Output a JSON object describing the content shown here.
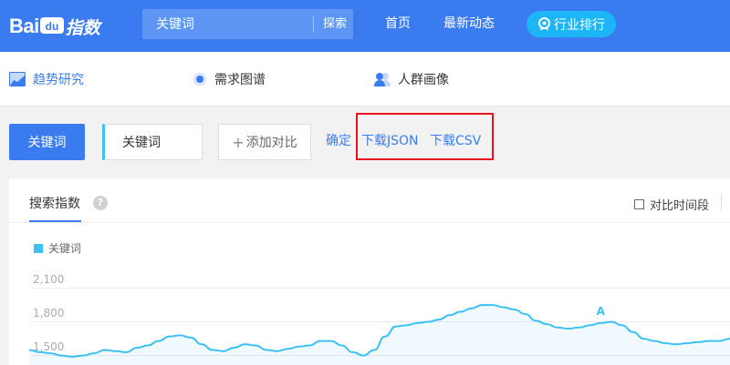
{
  "header": {
    "logo_text": "Bai",
    "logo_suffix": "指数",
    "search_placeholder": "关键词",
    "search_button": "探索",
    "nav": [
      "首页",
      "最新动态"
    ],
    "rank_button": "行业排行"
  },
  "tabs": [
    {
      "label": "趋势研究",
      "icon": "trend-icon"
    },
    {
      "label": "需求图谱",
      "icon": "target-icon"
    },
    {
      "label": "人群画像",
      "icon": "people-icon"
    }
  ],
  "controls": {
    "keyword_button": "关键词",
    "keyword_value": "关键词",
    "add_compare": "添加对比",
    "confirm": "确定",
    "download_json": "下载JSON",
    "download_csv": "下载CSV"
  },
  "panel": {
    "title": "搜索指数",
    "help_icon": "?",
    "compare_label": "对比时间段",
    "legend": "关键词",
    "annotation": "A"
  },
  "chart_data": {
    "type": "area",
    "series": [
      {
        "name": "关键词",
        "color": "#3bc1f2"
      }
    ],
    "y_ticks": [
      "2,100",
      "1,800",
      "1,500"
    ],
    "values": [
      1480,
      1460,
      1450,
      1430,
      1420,
      1430,
      1450,
      1480,
      1470,
      1460,
      1500,
      1520,
      1560,
      1600,
      1610,
      1590,
      1530,
      1480,
      1470,
      1500,
      1530,
      1520,
      1480,
      1470,
      1490,
      1510,
      1520,
      1560,
      1560,
      1520,
      1460,
      1430,
      1480,
      1600,
      1690,
      1700,
      1720,
      1730,
      1750,
      1790,
      1820,
      1850,
      1880,
      1880,
      1860,
      1840,
      1800,
      1740,
      1710,
      1680,
      1670,
      1680,
      1700,
      1720,
      1730,
      1700,
      1640,
      1580,
      1560,
      1540,
      1530,
      1540,
      1550,
      1560,
      1560,
      1580
    ],
    "annotations": [
      {
        "label": "A"
      }
    ]
  },
  "colors": {
    "brand": "#3a7cf0",
    "accent": "#3bc1f2",
    "highlight": "#e8141b"
  }
}
